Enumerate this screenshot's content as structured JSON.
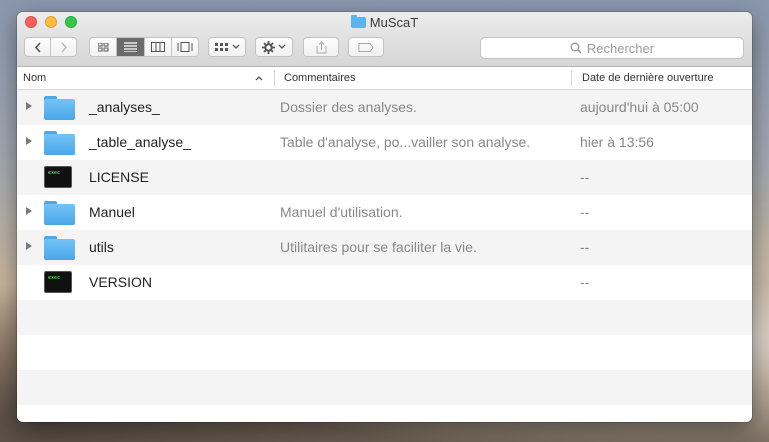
{
  "window": {
    "title": "MuScaT"
  },
  "toolbar": {
    "search_placeholder": "Rechercher"
  },
  "columns": {
    "name": "Nom",
    "comment": "Commentaires",
    "date": "Date de dernière ouverture"
  },
  "rows": [
    {
      "name": "_analyses_",
      "comment": "Dossier des analyses.",
      "date": "aujourd'hui à 05:00",
      "icon": "folder-icon"
    },
    {
      "name": "_table_analyse_",
      "comment": "Table d'analyse, po...vailler son analyse.",
      "date": "hier à 13:56",
      "icon": "folder-icon"
    },
    {
      "name": "LICENSE",
      "comment": "",
      "date": "--",
      "icon": "executable-icon"
    },
    {
      "name": "Manuel",
      "comment": "Manuel d'utilisation.",
      "date": "--",
      "icon": "folder-icon"
    },
    {
      "name": "utils",
      "comment": "Utilitaires pour se faciliter la vie.",
      "date": "--",
      "icon": "folder-icon"
    },
    {
      "name": "VERSION",
      "comment": "",
      "date": "--",
      "icon": "executable-icon"
    }
  ],
  "colors": {
    "folder": "#5ab5ee",
    "selected_view": "#6b6b6b"
  }
}
